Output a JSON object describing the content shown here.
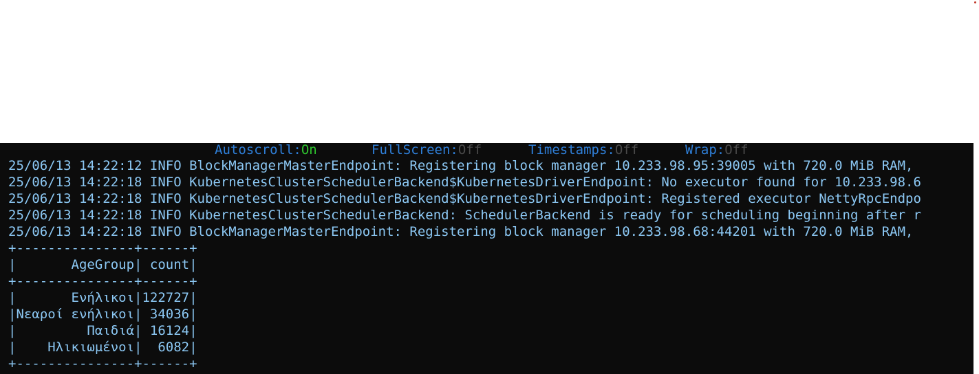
{
  "status_bar": {
    "autoscroll": {
      "label": "Autoscroll:",
      "value": "On"
    },
    "fullscreen": {
      "label": "FullScreen:",
      "value": "Off"
    },
    "timestamps": {
      "label": "Timestamps:",
      "value": "Off"
    },
    "wrap": {
      "label": "Wrap:",
      "value": "Off"
    }
  },
  "log_lines": [
    "25/06/13 14:22:12 INFO BlockManagerMasterEndpoint: Registering block manager 10.233.98.95:39005 with 720.0 MiB RAM,",
    "25/06/13 14:22:18 INFO KubernetesClusterSchedulerBackend$KubernetesDriverEndpoint: No executor found for 10.233.98.6",
    "25/06/13 14:22:18 INFO KubernetesClusterSchedulerBackend$KubernetesDriverEndpoint: Registered executor NettyRpcEndpo",
    "25/06/13 14:22:18 INFO KubernetesClusterSchedulerBackend: SchedulerBackend is ready for scheduling beginning after r",
    "25/06/13 14:22:18 INFO BlockManagerMasterEndpoint: Registering block manager 10.233.98.68:44201 with 720.0 MiB RAM,"
  ],
  "table": {
    "border_top": "+---------------+------+",
    "header": "|       AgeGroup| count|",
    "border_mid": "+---------------+------+",
    "rows": [
      "|       Ενήλικοι|122727|",
      "|Νεαροί ενήλικοι| 34036|",
      "|         Παιδιά| 16124|",
      "|    Ηλικιωμένοι|  6082|"
    ],
    "border_bottom": "+---------------+------+"
  },
  "colors": {
    "background": "#0c0c0c",
    "text": "#8cc8f4",
    "status_key": "#2f7fd8",
    "status_on": "#2ec42e",
    "status_off": "#4a4a4a"
  }
}
